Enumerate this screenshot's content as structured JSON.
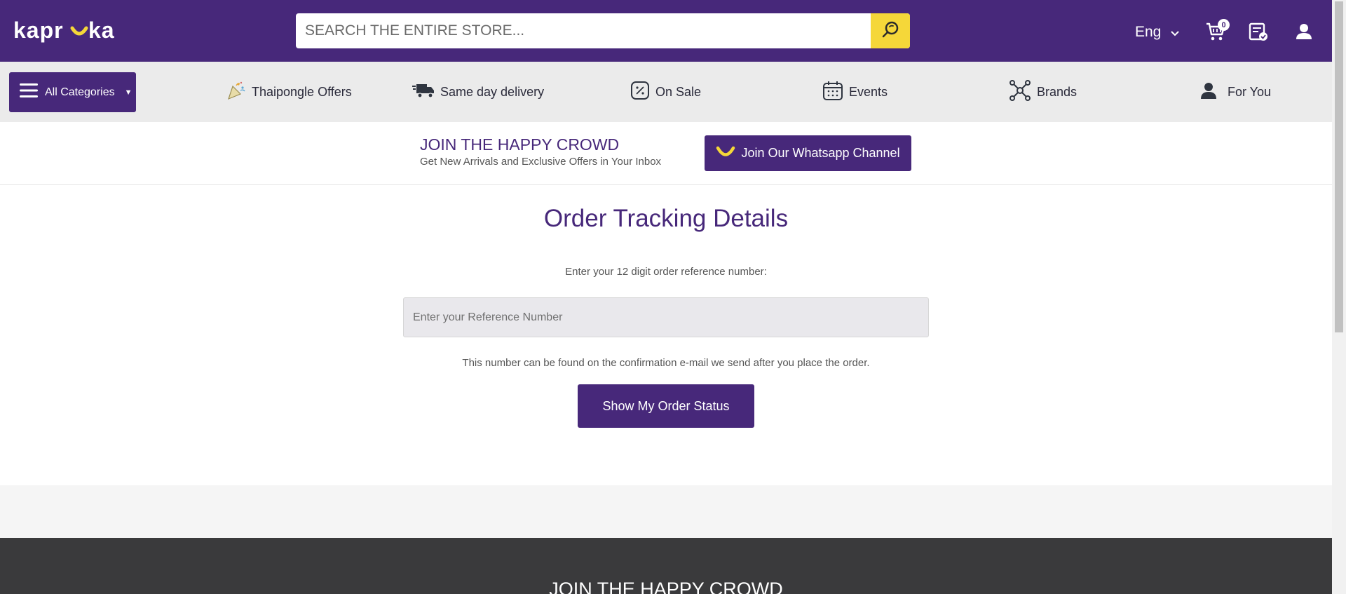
{
  "header": {
    "logo_text": "kapruka",
    "search_placeholder": "SEARCH THE ENTIRE STORE...",
    "language": "Eng",
    "cart_count": "0"
  },
  "nav": {
    "all_categories": "All Categories",
    "items": [
      {
        "label": "Thaipongle Offers",
        "icon": "party-popper-icon"
      },
      {
        "label": "Same day delivery",
        "icon": "delivery-truck-icon"
      },
      {
        "label": "On Sale",
        "icon": "discount-tag-icon"
      },
      {
        "label": "Events",
        "icon": "calendar-icon"
      },
      {
        "label": "Brands",
        "icon": "network-icon"
      },
      {
        "label": "For You",
        "icon": "user-icon"
      }
    ]
  },
  "promo": {
    "title": "JOIN THE HAPPY CROWD",
    "subtitle": "Get New Arrivals and Exclusive Offers in Your Inbox",
    "whatsapp_button": "Join Our Whatsapp Channel"
  },
  "main": {
    "title": "Order Tracking Details",
    "instruction": "Enter your 12 digit order reference number:",
    "reference_placeholder": "Enter your Reference Number",
    "reference_value": "",
    "hint": "This number can be found on the confirmation e-mail we send after you place the order.",
    "submit_button": "Show My Order Status"
  },
  "footer": {
    "title": "JOIN THE HAPPY CROWD"
  },
  "colors": {
    "brand_purple": "#47287a",
    "accent_yellow": "#f5d739",
    "nav_bg": "#ebebeb",
    "footer_bg": "#3a3a3c"
  }
}
